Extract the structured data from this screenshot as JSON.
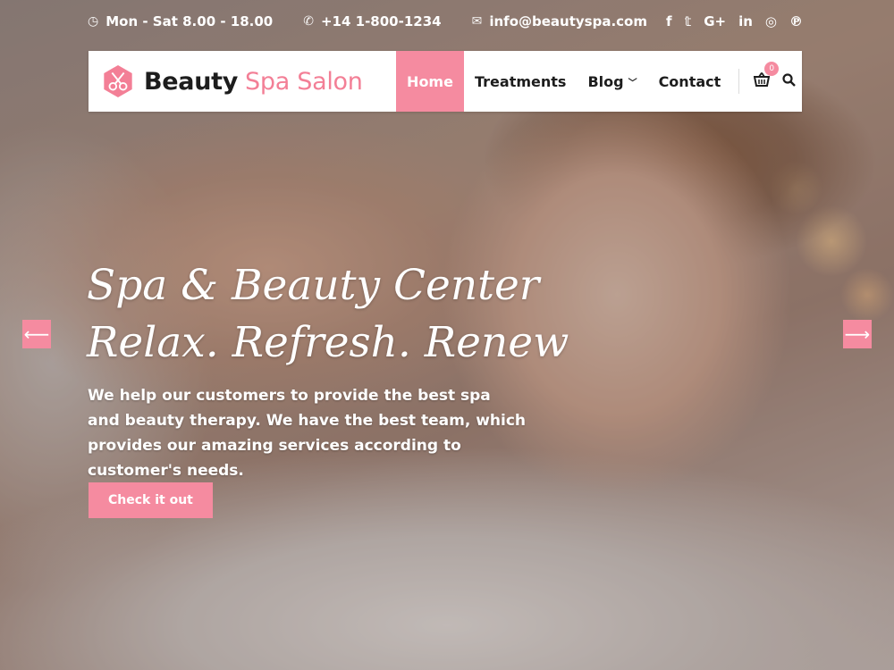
{
  "topbar": {
    "hours": "Mon - Sat 8.00 - 18.00",
    "phone": "+14 1-800-1234",
    "email": "info@beautyspa.com",
    "socials": [
      "facebook",
      "twitter",
      "google-plus",
      "linkedin",
      "instagram",
      "pinterest"
    ]
  },
  "brand": {
    "name_part1": "Beauty",
    "name_part2": "Spa Salon",
    "accent_color": "#f58ba0"
  },
  "nav": {
    "items": [
      {
        "label": "Home",
        "active": true
      },
      {
        "label": "Treatments"
      },
      {
        "label": "Blog",
        "has_dropdown": true
      },
      {
        "label": "Contact"
      }
    ],
    "cart_count": "0"
  },
  "hero": {
    "title_line1": "Spa & Beauty Center",
    "title_line2": "Relax. Refresh. Renew",
    "description": "We help our customers to provide the best spa and beauty therapy. We have the best team, which provides our amazing services according to customer's needs.",
    "cta_label": "Check it out"
  }
}
